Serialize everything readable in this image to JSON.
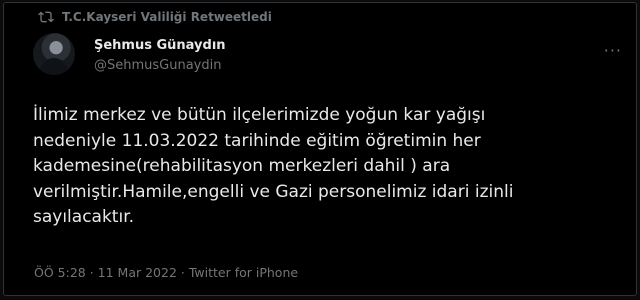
{
  "retweet": {
    "icon": "retweet-icon",
    "text": "T.C.Kayseri Valiliği Retweetledi"
  },
  "author": {
    "avatar": "avatar",
    "name": "Şehmus Günaydın",
    "handle": "@SehmusGunaydin"
  },
  "menu": {
    "icon": "more-icon",
    "label": "···"
  },
  "tweet": {
    "text": "İlimiz merkez ve bütün ilçelerimizde yoğun kar yağışı\nnedeniyle 11.03.2022 tarihinde eğitim öğretimin her\nkademesine(rehabilitasyon merkezleri dahil ) ara\nverilmiştir.Hamile,engelli ve Gazi personelimiz idari izinli\nsayılacaktır."
  },
  "meta": {
    "time": "ÖÖ 5:28",
    "sep1": " · ",
    "date": "11 Mar 2022",
    "sep2": " · ",
    "source": "Twitter for iPhone"
  },
  "colors": {
    "background": "#000000",
    "text": "#e7e9ea",
    "secondary": "#71767b",
    "border": "#2f3336"
  }
}
